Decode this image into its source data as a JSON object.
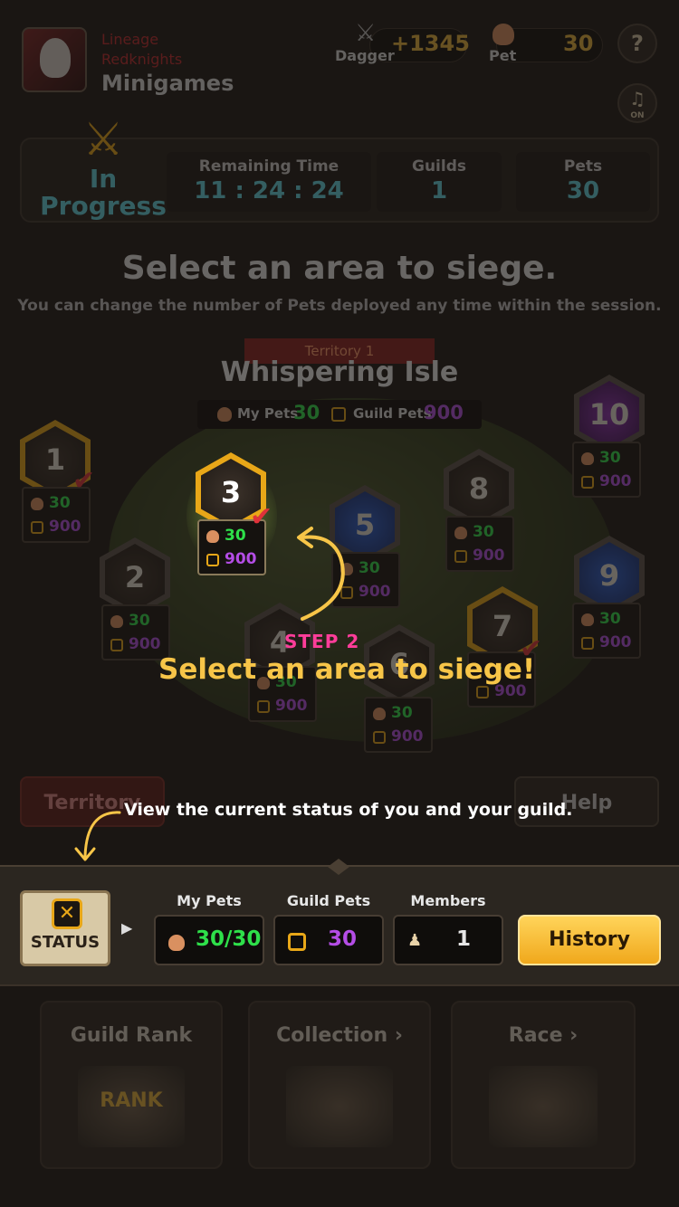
{
  "header": {
    "user_line1": "Lineage",
    "user_line2": "Redknights",
    "user_line3": "Minigames",
    "dagger_label": "Dagger",
    "dagger_value": "+1345",
    "pet_label": "Pet",
    "pet_value": "30",
    "help_label": "?",
    "music_label": "♫",
    "music_state": "ON"
  },
  "banner": {
    "status_line1": "In",
    "status_line2": "Progress",
    "remaining_label": "Remaining Time",
    "remaining_value": "11 : 24 : 24",
    "guilds_label": "Guilds",
    "guilds_value": "1",
    "pets_label": "Pets",
    "pets_value": "30"
  },
  "titles": {
    "main": "Select an area to siege.",
    "sub": "You can change the number of Pets deployed any time within the session."
  },
  "territory": {
    "tag": "Territory 1",
    "name": "Whispering Isle",
    "my_pets_label": "My Pets",
    "my_pets_value": "30",
    "guild_pets_label": "Guild Pets",
    "guild_pets_value": "900"
  },
  "areas": [
    {
      "num": "1",
      "my": "30",
      "guild": "900",
      "checked": true
    },
    {
      "num": "2",
      "my": "30",
      "guild": "900",
      "checked": false
    },
    {
      "num": "3",
      "my": "30",
      "guild": "900",
      "checked": true
    },
    {
      "num": "4",
      "my": "30",
      "guild": "900",
      "checked": false
    },
    {
      "num": "5",
      "my": "30",
      "guild": "900",
      "checked": false
    },
    {
      "num": "6",
      "my": "30",
      "guild": "900",
      "checked": false
    },
    {
      "num": "7",
      "my": "-",
      "guild": "900",
      "checked": true
    },
    {
      "num": "8",
      "my": "30",
      "guild": "900",
      "checked": false
    },
    {
      "num": "9",
      "my": "30",
      "guild": "900",
      "checked": false
    },
    {
      "num": "10",
      "my": "30",
      "guild": "900",
      "checked": false
    }
  ],
  "tutorial": {
    "step_label": "STEP 2",
    "step_text": "Select an area to siege!",
    "hint_text": "View the current status of you and your guild."
  },
  "side_buttons": {
    "territory": "Territory",
    "help": "Help"
  },
  "status_bar": {
    "badge_label": "STATUS",
    "my_pets_label": "My Pets",
    "my_pets_value": "30/30",
    "guild_pets_label": "Guild Pets",
    "guild_pets_value": "30",
    "members_label": "Members",
    "members_value": "1",
    "history_label": "History"
  },
  "cards": {
    "guild_rank": "Guild Rank",
    "rank_badge": "RANK",
    "collection": "Collection ›",
    "race": "Race ›"
  },
  "colors": {
    "accent_gold": "#f7c548",
    "step_pink": "#ff3d9a",
    "my_pets_green": "#2ee04a",
    "guild_pets_purple": "#b44de6",
    "timer_cyan": "#5fd3e0"
  }
}
